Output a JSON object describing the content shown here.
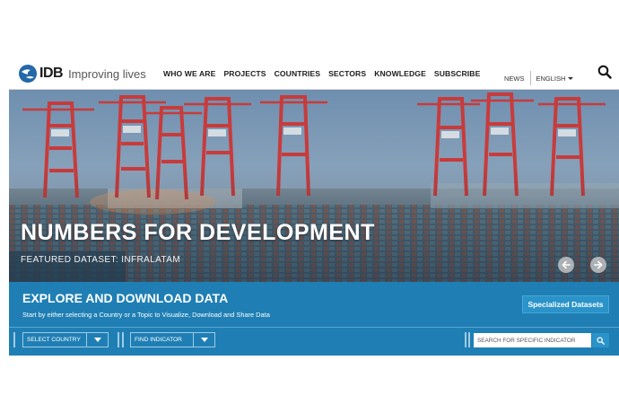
{
  "brand": {
    "logo": "IDB",
    "tagline": "Improving lives"
  },
  "nav": {
    "items": [
      {
        "label": "WHO WE ARE"
      },
      {
        "label": "PROJECTS"
      },
      {
        "label": "COUNTRIES"
      },
      {
        "label": "SECTORS"
      },
      {
        "label": "KNOWLEDGE"
      },
      {
        "label": "SUBSCRIBE"
      }
    ]
  },
  "utility": {
    "news": "NEWS",
    "language": "ENGLISH"
  },
  "hero": {
    "title": "NUMBERS FOR DEVELOPMENT",
    "subtitle": "FEATURED DATASET: INFRALATAM"
  },
  "explore": {
    "title": "EXPLORE AND DOWNLOAD DATA",
    "subtitle": "Start by either selecting a Country or a Topic to Visualize, Download and Share Data",
    "specialized_button": "Specialized Datasets",
    "select_country": "SELECT COUNTRY",
    "find_indicator": "FIND INDICATOR",
    "search_placeholder": "SEARCH FOR SPECIFIC INDICATOR"
  },
  "colors": {
    "band": "#1f7fb4",
    "button": "#2a93c9",
    "logo_blue": "#2368a8"
  },
  "icons": [
    "idb-logo-icon",
    "search-icon",
    "chevron-down-icon",
    "arrow-left-icon",
    "arrow-right-icon"
  ]
}
